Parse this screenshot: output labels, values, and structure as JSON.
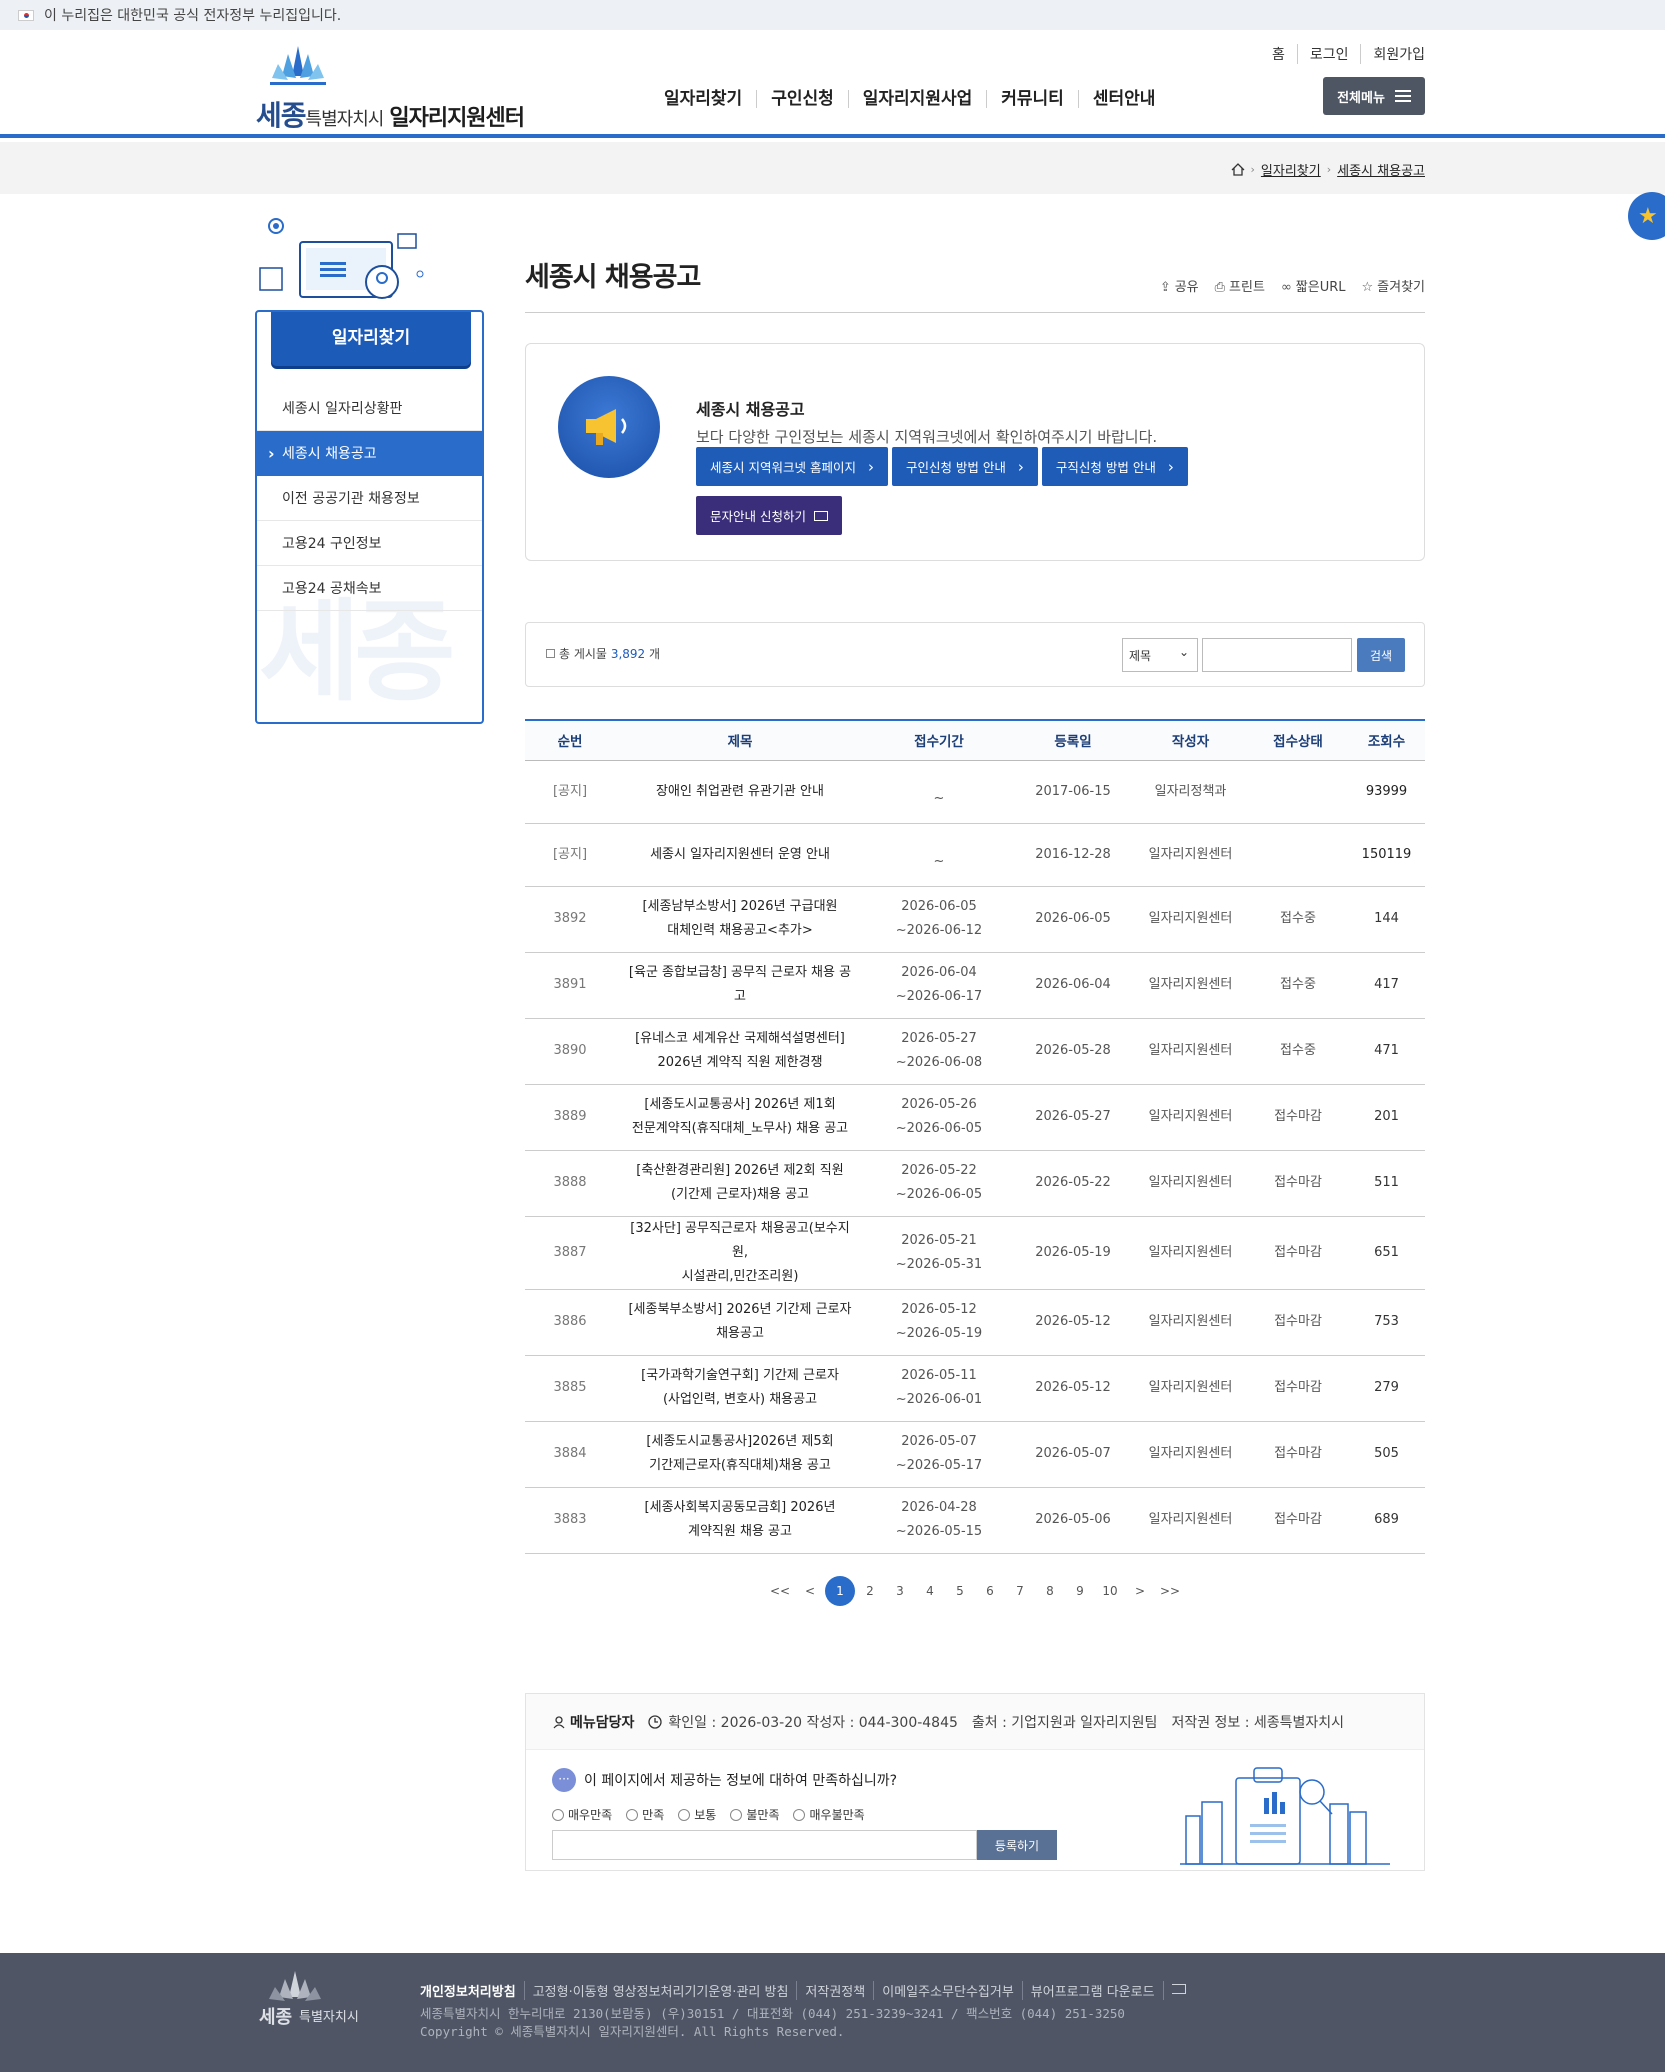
{
  "gov_banner": {
    "text": "이 누리집은 대한민국 공식 전자정부 누리집입니다."
  },
  "logo": {
    "brand": "세종",
    "sub": "특별자치시",
    "main": "일자리지원센터"
  },
  "util_links": [
    "홈",
    "로그인",
    "회원가입"
  ],
  "gnb": [
    "일자리찾기",
    "구인신청",
    "일자리지원사업",
    "커뮤니티",
    "센터안내"
  ],
  "all_menu_label": "전체메뉴",
  "breadcrumb": [
    "일자리찾기",
    "세종시 채용공고"
  ],
  "side": {
    "title": "일자리찾기",
    "items": [
      "세종시 일자리상황판",
      "세종시 채용공고",
      "이전 공공기관 채용정보",
      "고용24 구인정보",
      "고용24 공채속보"
    ],
    "active_index": 1,
    "watermark": "세종"
  },
  "page_title": "세종시 채용공고",
  "tools": {
    "share": "공유",
    "print": "프린트",
    "short_url": "짧은URL",
    "favorite": "즐겨찾기"
  },
  "info": {
    "title": "세종시 채용공고",
    "desc": "보다 다양한 구인정보는 세종시 지역워크넷에서 확인하여주시기 바랍니다.",
    "buttons": [
      "세종시 지역워크넷 홈페이지",
      "구인신청 방법 안내",
      "구직신청 방법 안내"
    ],
    "sms_button": "문자안내 신청하기"
  },
  "search": {
    "count_prefix": "총 게시물",
    "count": "3,892",
    "count_suffix": "개",
    "field": "제목",
    "button": "검색"
  },
  "board": {
    "headers": [
      "순번",
      "제목",
      "접수기간",
      "등록일",
      "작성자",
      "접수상태",
      "조회수"
    ],
    "rows": [
      {
        "no": "[공지]",
        "title": [
          "장애인 취업관련 유관기관 안내"
        ],
        "period": [
          "",
          "~"
        ],
        "date": "2017-06-15",
        "writer": "일자리정책과",
        "status": "",
        "hits": "93999",
        "notice": true
      },
      {
        "no": "[공지]",
        "title": [
          "세종시 일자리지원센터 운영 안내"
        ],
        "period": [
          "",
          "~"
        ],
        "date": "2016-12-28",
        "writer": "일자리지원센터",
        "status": "",
        "hits": "150119",
        "notice": true
      },
      {
        "no": "3892",
        "title": [
          "[세종남부소방서] 2026년 구급대원",
          "대체인력 채용공고<추가>"
        ],
        "period": [
          "2026-06-05",
          "~2026-06-12"
        ],
        "date": "2026-06-05",
        "writer": "일자리지원센터",
        "status": "접수중",
        "hits": "144"
      },
      {
        "no": "3891",
        "title": [
          "[육군 종합보급창] 공무직 근로자 채용 공고"
        ],
        "period": [
          "2026-06-04",
          "~2026-06-17"
        ],
        "date": "2026-06-04",
        "writer": "일자리지원센터",
        "status": "접수중",
        "hits": "417"
      },
      {
        "no": "3890",
        "title": [
          "[유네스코 세계유산 국제해석설명센터]",
          "2026년 계약직 직원 제한경쟁"
        ],
        "period": [
          "2026-05-27",
          "~2026-06-08"
        ],
        "date": "2026-05-28",
        "writer": "일자리지원센터",
        "status": "접수중",
        "hits": "471"
      },
      {
        "no": "3889",
        "title": [
          "[세종도시교통공사] 2026년 제1회",
          "전문계약직(휴직대체_노무사) 채용 공고"
        ],
        "period": [
          "2026-05-26",
          "~2026-06-05"
        ],
        "date": "2026-05-27",
        "writer": "일자리지원센터",
        "status": "접수마감",
        "hits": "201"
      },
      {
        "no": "3888",
        "title": [
          "[축산환경관리원] 2026년 제2회 직원",
          "(기간제 근로자)채용 공고"
        ],
        "period": [
          "2026-05-22",
          "~2026-06-05"
        ],
        "date": "2026-05-22",
        "writer": "일자리지원센터",
        "status": "접수마감",
        "hits": "511"
      },
      {
        "no": "3887",
        "title": [
          "[32사단] 공무직근로자 채용공고(보수지원,",
          "시설관리,민간조리원)"
        ],
        "period": [
          "2026-05-21",
          "~2026-05-31"
        ],
        "date": "2026-05-19",
        "writer": "일자리지원센터",
        "status": "접수마감",
        "hits": "651"
      },
      {
        "no": "3886",
        "title": [
          "[세종북부소방서] 2026년 기간제 근로자",
          "채용공고"
        ],
        "period": [
          "2026-05-12",
          "~2026-05-19"
        ],
        "date": "2026-05-12",
        "writer": "일자리지원센터",
        "status": "접수마감",
        "hits": "753"
      },
      {
        "no": "3885",
        "title": [
          "[국가과학기술연구회] 기간제 근로자",
          "(사업인력, 변호사) 채용공고"
        ],
        "period": [
          "2026-05-11",
          "~2026-06-01"
        ],
        "date": "2026-05-12",
        "writer": "일자리지원센터",
        "status": "접수마감",
        "hits": "279"
      },
      {
        "no": "3884",
        "title": [
          "[세종도시교통공사]2026년 제5회",
          "기간제근로자(휴직대체)채용 공고"
        ],
        "period": [
          "2026-05-07",
          "~2026-05-17"
        ],
        "date": "2026-05-07",
        "writer": "일자리지원센터",
        "status": "접수마감",
        "hits": "505"
      },
      {
        "no": "3883",
        "title": [
          "[세종사회복지공동모금회] 2026년",
          "계약직원 채용 공고"
        ],
        "period": [
          "2026-04-28",
          "~2026-05-15"
        ],
        "date": "2026-05-06",
        "writer": "일자리지원센터",
        "status": "접수마감",
        "hits": "689"
      }
    ]
  },
  "pager": {
    "items": [
      "<<",
      "<",
      "1",
      "2",
      "3",
      "4",
      "5",
      "6",
      "7",
      "8",
      "9",
      "10",
      ">",
      ">>"
    ],
    "current": "1"
  },
  "satisfaction": {
    "manager_label": "메뉴담당자",
    "meta": "확인일 : 2026-03-20 작성자 : 044-300-4845",
    "source": "출처 : 기업지원과 일자리지원팀",
    "copyright": "저작권 정보 : 세종특별자치시",
    "question": "이 페이지에서 제공하는 정보에 대하여 만족하십니까?",
    "options": [
      "매우만족",
      "만족",
      "보통",
      "불만족",
      "매우불만족"
    ],
    "submit": "등록하기"
  },
  "footer": {
    "logo_brand": "세종",
    "logo_sub": "특별자치시",
    "links": [
      "개인정보처리방침",
      "고정형·이동형 영상정보처리기기운영·관리 방침",
      "저작권정책",
      "이메일주소무단수집거부",
      "뷰어프로그램 다운로드"
    ],
    "address": "세종특별자치시 한누리대로 2130(보람동) (우)30151 / 대표전화 (044) 251-3239~3241 / 팩스번호 (044) 251-3250",
    "copyright": "Copyright © 세종특별자치시 일자리지원센터. All Rights Reserved."
  },
  "colors": {
    "primary": "#2a6cc9",
    "dark_blue": "#1d5bb8",
    "purple": "#3a2e7a",
    "footer_bg": "#4f5564"
  }
}
